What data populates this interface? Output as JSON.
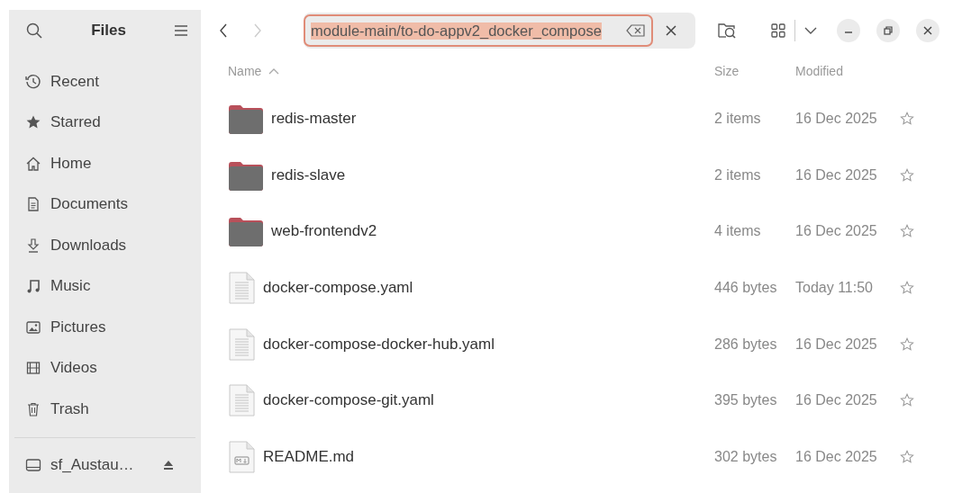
{
  "sidebar": {
    "title": "Files",
    "items": [
      {
        "label": "Recent",
        "kind": "recent",
        "selected": false
      },
      {
        "label": "Starred",
        "kind": "starred",
        "selected": false
      },
      {
        "label": "Home",
        "kind": "home",
        "selected": false
      },
      {
        "label": "Documents",
        "kind": "documents",
        "selected": false
      },
      {
        "label": "Downloads",
        "kind": "downloads",
        "selected": false
      },
      {
        "label": "Music",
        "kind": "music",
        "selected": false
      },
      {
        "label": "Pictures",
        "kind": "pictures",
        "selected": false
      },
      {
        "label": "Videos",
        "kind": "videos",
        "selected": false
      },
      {
        "label": "Trash",
        "kind": "trash",
        "selected": false
      }
    ],
    "drives": [
      {
        "label": "sf_Austau…",
        "selected": false
      }
    ]
  },
  "toolbar": {
    "location": {
      "value": "module-main/to-do-appv2_docker_compose"
    }
  },
  "table": {
    "columns": [
      {
        "label": "Name",
        "sorted": true
      },
      {
        "label": "Size",
        "sorted": false
      },
      {
        "label": "Modified",
        "sorted": false
      }
    ],
    "rows": [
      {
        "name": "redis-master",
        "kind": "folder",
        "size": "2 items",
        "modified": "16 Dec 2025",
        "starred": false
      },
      {
        "name": "redis-slave",
        "kind": "folder",
        "size": "2 items",
        "modified": "16 Dec 2025",
        "starred": false
      },
      {
        "name": "web-frontendv2",
        "kind": "folder",
        "size": "4 items",
        "modified": "16 Dec 2025",
        "starred": false
      },
      {
        "name": "docker-compose.yaml",
        "kind": "text",
        "size": "446 bytes",
        "modified": "Today 11:50",
        "starred": false
      },
      {
        "name": "docker-compose-docker-hub.yaml",
        "kind": "text",
        "size": "286 bytes",
        "modified": "16 Dec 2025",
        "starred": false
      },
      {
        "name": "docker-compose-git.yaml",
        "kind": "text",
        "size": "395 bytes",
        "modified": "16 Dec 2025",
        "starred": false
      },
      {
        "name": "README.md",
        "kind": "markdown",
        "size": "302 bytes",
        "modified": "16 Dec 2025",
        "starred": false
      }
    ]
  }
}
